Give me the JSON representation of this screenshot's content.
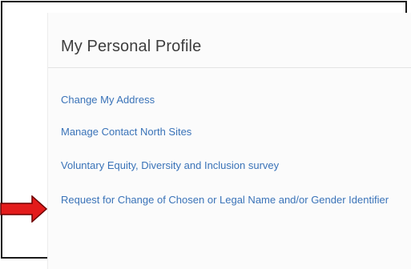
{
  "panel": {
    "title": "My Personal Profile",
    "links": [
      {
        "label": "Change My Address"
      },
      {
        "label": "Manage Contact North Sites"
      },
      {
        "label": "Voluntary Equity, Diversity and Inclusion survey"
      },
      {
        "label": "Request for Change of Chosen or Legal Name and/or Gender Identifier"
      }
    ]
  },
  "annotation": {
    "arrow_icon": "arrow-right-icon",
    "arrow_color": "#e31b1b",
    "arrow_outline": "#6b0000"
  },
  "colors": {
    "link": "#3a73b8",
    "title": "#3d3d3d"
  }
}
